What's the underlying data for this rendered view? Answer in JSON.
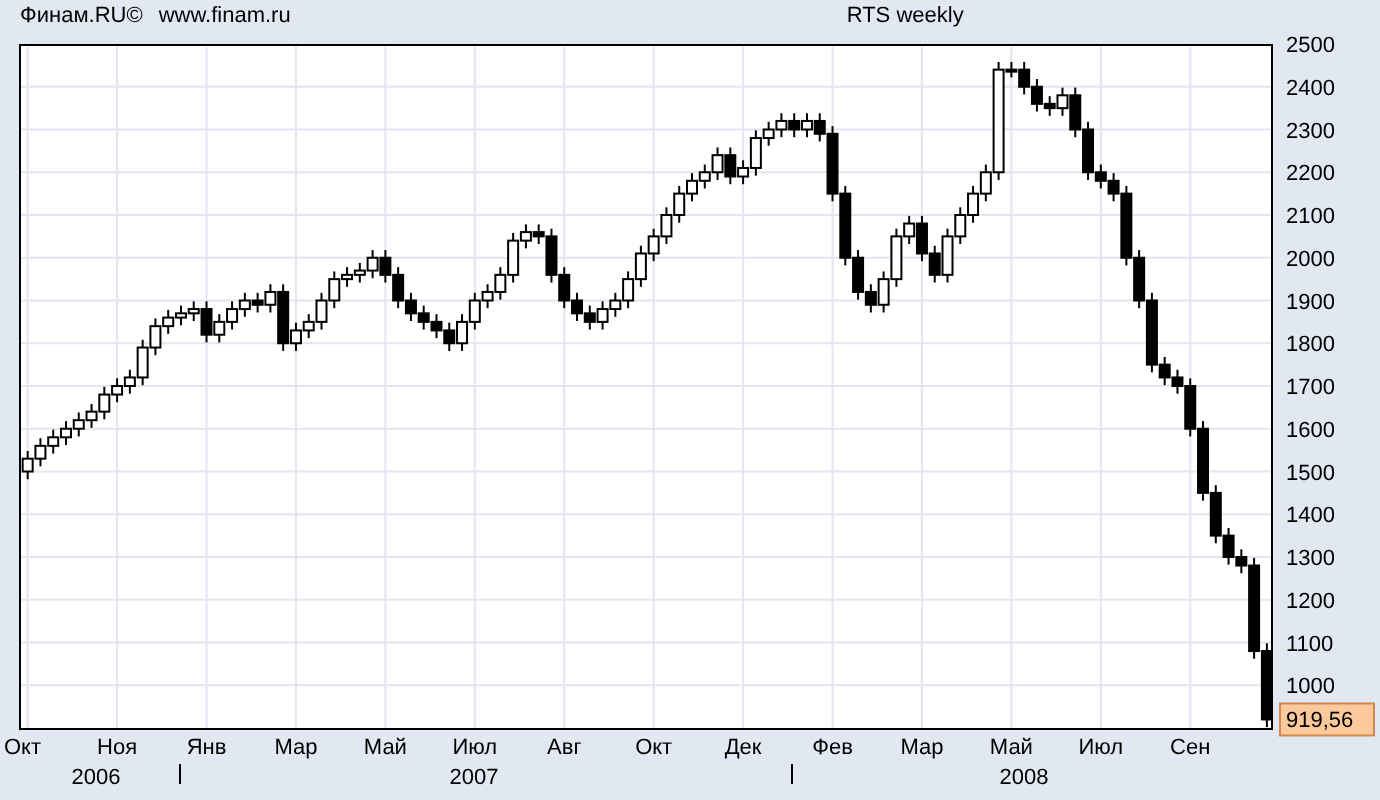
{
  "header": {
    "source": "Финам.RU©",
    "url": "www.finam.ru"
  },
  "chart": {
    "chart_data": {
      "type": "candlestick",
      "title": "RTS weekly",
      "grid": true,
      "ylim": [
        900,
        2500
      ],
      "yticks": [
        1000,
        1100,
        1200,
        1300,
        1400,
        1500,
        1600,
        1700,
        1800,
        1900,
        2000,
        2100,
        2200,
        2300,
        2400,
        2500
      ],
      "categories": [
        "Окт",
        null,
        null,
        null,
        null,
        null,
        null,
        "Ноя",
        null,
        null,
        null,
        null,
        null,
        null,
        "Янв",
        null,
        null,
        null,
        null,
        null,
        null,
        "Мар",
        null,
        null,
        null,
        null,
        null,
        null,
        "Май",
        null,
        null,
        null,
        null,
        null,
        null,
        "Июл",
        null,
        null,
        null,
        null,
        null,
        null,
        "Авг",
        null,
        null,
        null,
        null,
        null,
        null,
        "Окт",
        null,
        null,
        null,
        null,
        null,
        null,
        "Дек",
        null,
        null,
        null,
        null,
        null,
        null,
        "Фев",
        null,
        null,
        null,
        null,
        null,
        null,
        "Мар",
        null,
        null,
        null,
        null,
        null,
        null,
        "Май",
        null,
        null,
        null,
        null,
        null,
        null,
        "Июл",
        null,
        null,
        null,
        null,
        null,
        null,
        "Сен",
        null,
        null,
        null,
        null,
        null,
        null
      ],
      "ohlc": [
        [
          1500,
          1548,
          1482,
          1530
        ],
        [
          1530,
          1578,
          1512,
          1560
        ],
        [
          1560,
          1598,
          1542,
          1580
        ],
        [
          1580,
          1618,
          1562,
          1600
        ],
        [
          1600,
          1638,
          1582,
          1620
        ],
        [
          1620,
          1658,
          1602,
          1640
        ],
        [
          1640,
          1698,
          1622,
          1680
        ],
        [
          1680,
          1718,
          1662,
          1700
        ],
        [
          1700,
          1738,
          1682,
          1720
        ],
        [
          1720,
          1808,
          1702,
          1790
        ],
        [
          1790,
          1858,
          1772,
          1840
        ],
        [
          1840,
          1878,
          1822,
          1860
        ],
        [
          1860,
          1888,
          1842,
          1870
        ],
        [
          1870,
          1898,
          1852,
          1880
        ],
        [
          1880,
          1898,
          1802,
          1820
        ],
        [
          1820,
          1868,
          1802,
          1850
        ],
        [
          1850,
          1898,
          1832,
          1880
        ],
        [
          1880,
          1918,
          1862,
          1900
        ],
        [
          1900,
          1918,
          1872,
          1890
        ],
        [
          1890,
          1938,
          1872,
          1920
        ],
        [
          1920,
          1938,
          1782,
          1800
        ],
        [
          1800,
          1848,
          1782,
          1830
        ],
        [
          1830,
          1868,
          1812,
          1850
        ],
        [
          1850,
          1918,
          1832,
          1900
        ],
        [
          1900,
          1968,
          1882,
          1950
        ],
        [
          1950,
          1978,
          1932,
          1960
        ],
        [
          1960,
          1988,
          1942,
          1970
        ],
        [
          1970,
          2018,
          1952,
          2000
        ],
        [
          2000,
          2018,
          1942,
          1960
        ],
        [
          1960,
          1978,
          1882,
          1900
        ],
        [
          1900,
          1918,
          1852,
          1870
        ],
        [
          1870,
          1888,
          1832,
          1850
        ],
        [
          1850,
          1868,
          1812,
          1830
        ],
        [
          1830,
          1848,
          1782,
          1800
        ],
        [
          1800,
          1868,
          1782,
          1850
        ],
        [
          1850,
          1918,
          1832,
          1900
        ],
        [
          1900,
          1938,
          1882,
          1920
        ],
        [
          1920,
          1978,
          1902,
          1960
        ],
        [
          1960,
          2058,
          1942,
          2040
        ],
        [
          2040,
          2078,
          2022,
          2060
        ],
        [
          2060,
          2078,
          2032,
          2050
        ],
        [
          2050,
          2068,
          1942,
          1960
        ],
        [
          1960,
          1978,
          1882,
          1900
        ],
        [
          1900,
          1918,
          1852,
          1870
        ],
        [
          1870,
          1888,
          1832,
          1850
        ],
        [
          1850,
          1898,
          1832,
          1880
        ],
        [
          1880,
          1918,
          1862,
          1900
        ],
        [
          1900,
          1968,
          1882,
          1950
        ],
        [
          1950,
          2028,
          1932,
          2010
        ],
        [
          2010,
          2068,
          1992,
          2050
        ],
        [
          2050,
          2118,
          2032,
          2100
        ],
        [
          2100,
          2168,
          2082,
          2150
        ],
        [
          2150,
          2198,
          2132,
          2180
        ],
        [
          2180,
          2218,
          2162,
          2200
        ],
        [
          2200,
          2258,
          2182,
          2240
        ],
        [
          2240,
          2258,
          2172,
          2190
        ],
        [
          2190,
          2228,
          2172,
          2210
        ],
        [
          2210,
          2298,
          2192,
          2280
        ],
        [
          2280,
          2318,
          2262,
          2300
        ],
        [
          2300,
          2338,
          2282,
          2320
        ],
        [
          2320,
          2338,
          2282,
          2300
        ],
        [
          2300,
          2338,
          2282,
          2320
        ],
        [
          2320,
          2338,
          2272,
          2290
        ],
        [
          2290,
          2308,
          2132,
          2150
        ],
        [
          2150,
          2168,
          1982,
          2000
        ],
        [
          2000,
          2018,
          1902,
          1920
        ],
        [
          1920,
          1938,
          1872,
          1890
        ],
        [
          1890,
          1968,
          1872,
          1950
        ],
        [
          1950,
          2068,
          1932,
          2050
        ],
        [
          2050,
          2098,
          2032,
          2080
        ],
        [
          2080,
          2098,
          1992,
          2010
        ],
        [
          2010,
          2028,
          1942,
          1960
        ],
        [
          1960,
          2068,
          1942,
          2050
        ],
        [
          2050,
          2118,
          2032,
          2100
        ],
        [
          2100,
          2168,
          2082,
          2150
        ],
        [
          2150,
          2218,
          2132,
          2200
        ],
        [
          2200,
          2458,
          2182,
          2440
        ],
        [
          2440,
          2458,
          2422,
          2440
        ],
        [
          2440,
          2458,
          2382,
          2400
        ],
        [
          2400,
          2418,
          2342,
          2360
        ],
        [
          2360,
          2378,
          2332,
          2350
        ],
        [
          2350,
          2398,
          2332,
          2380
        ],
        [
          2380,
          2398,
          2282,
          2300
        ],
        [
          2300,
          2318,
          2182,
          2200
        ],
        [
          2200,
          2218,
          2162,
          2180
        ],
        [
          2180,
          2198,
          2132,
          2150
        ],
        [
          2150,
          2168,
          1982,
          2000
        ],
        [
          2000,
          2018,
          1882,
          1900
        ],
        [
          1900,
          1918,
          1732,
          1750
        ],
        [
          1750,
          1768,
          1702,
          1720
        ],
        [
          1720,
          1738,
          1682,
          1700
        ],
        [
          1700,
          1718,
          1582,
          1600
        ],
        [
          1600,
          1618,
          1432,
          1450
        ],
        [
          1450,
          1468,
          1332,
          1350
        ],
        [
          1350,
          1368,
          1282,
          1300
        ],
        [
          1300,
          1318,
          1262,
          1280
        ],
        [
          1280,
          1298,
          1062,
          1080
        ],
        [
          1080,
          1098,
          902,
          920
        ]
      ]
    },
    "years": [
      "2006",
      "2007",
      "2008"
    ],
    "last_price": "919,56"
  }
}
